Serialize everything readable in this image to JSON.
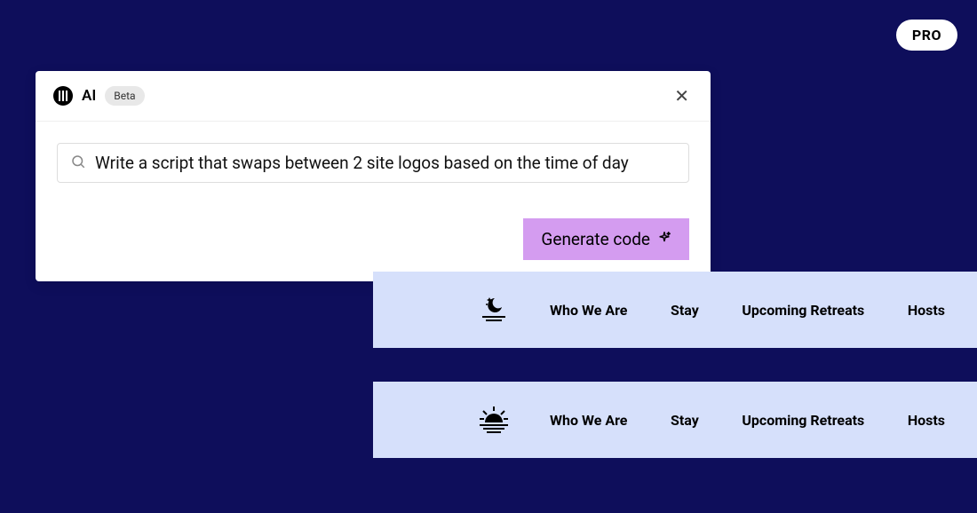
{
  "pro_badge": "PRO",
  "ai_panel": {
    "title": "AI",
    "beta_label": "Beta",
    "prompt_value": "Write a script that swaps between 2 site logos based on the time of day",
    "generate_label": "Generate code"
  },
  "nav": {
    "items": [
      "Who We Are",
      "Stay",
      "Upcoming Retreats",
      "Hosts"
    ]
  }
}
